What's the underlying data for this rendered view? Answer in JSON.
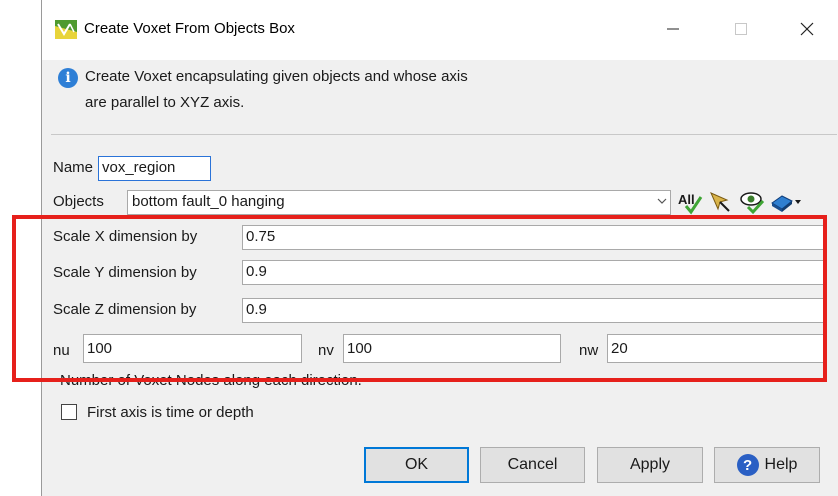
{
  "window": {
    "title": "Create Voxet From Objects Box",
    "controls": {
      "minimize": "—",
      "maximize": "☐",
      "close": "✕"
    },
    "app_icon": "voxet-app-icon"
  },
  "info": {
    "icon": "info-icon",
    "icon_glyph": "i",
    "line1": "Create Voxet encapsulating given objects and whose axis",
    "line2": "are parallel to XYZ axis."
  },
  "form": {
    "name_label": "Name",
    "name_value": "vox_region",
    "objects_label": "Objects",
    "objects_value": "bottom fault_0 hanging",
    "toolbar_icons": [
      "select-all-icon",
      "pick-cursor-icon",
      "visible-eye-icon",
      "object-type-icon"
    ],
    "all_icon_text": "All",
    "scale_x_label": "Scale X dimension by",
    "scale_x_value": "0.75",
    "scale_y_label": "Scale Y dimension by",
    "scale_y_value": "0.9",
    "scale_z_label": "Scale Z dimension by",
    "scale_z_value": "0.9",
    "nu_label": "nu",
    "nu_value": "100",
    "nv_label": "nv",
    "nv_value": "100",
    "nw_label": "nw",
    "nw_value": "20",
    "nodes_hint": "Number of Voxet Nodes along each direction.",
    "first_axis_label": "First axis is time or depth",
    "first_axis_checked": false
  },
  "buttons": {
    "ok": "OK",
    "cancel": "Cancel",
    "apply": "Apply",
    "help": "Help",
    "help_glyph": "?"
  },
  "colors": {
    "highlight_box": "#e6201b",
    "focus_border": "#2a73d8",
    "info_blue": "#2e7fd6"
  }
}
